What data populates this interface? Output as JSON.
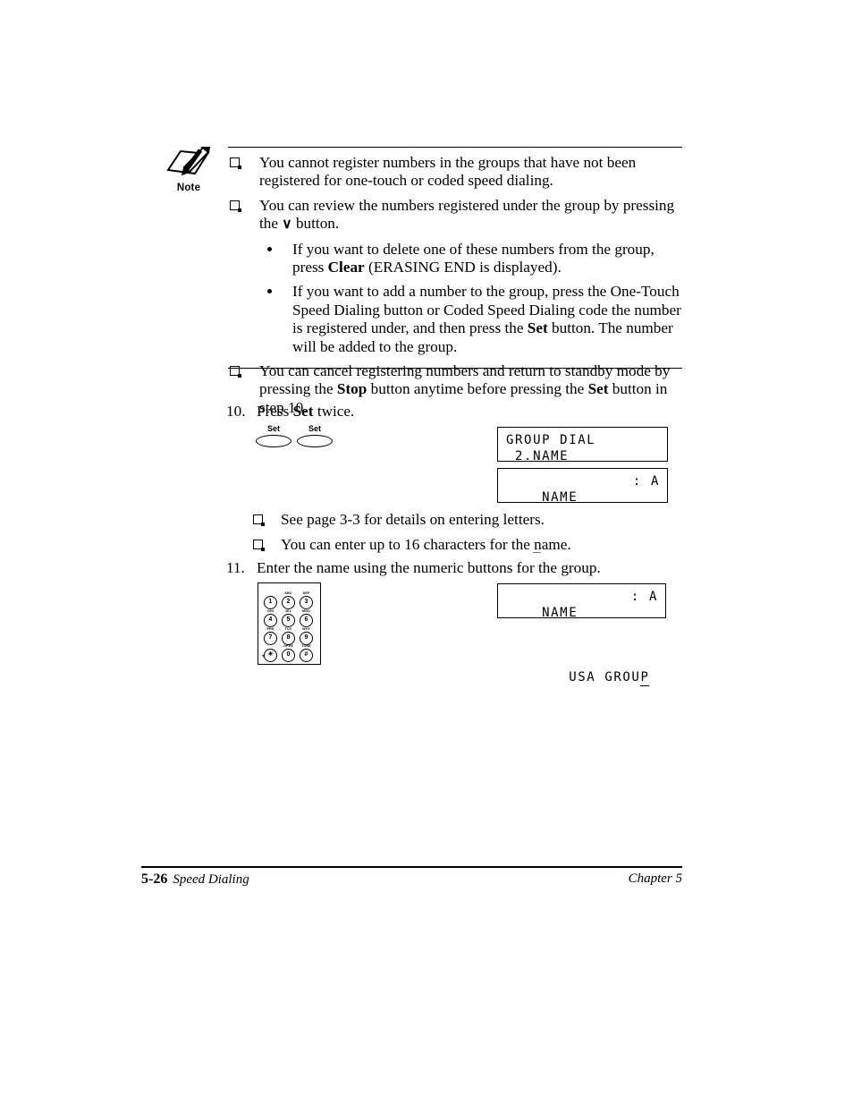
{
  "note_block": {
    "icon_name": "note-pencil-icon",
    "icon_label": "Note",
    "items": [
      {
        "type": "square",
        "segments": [
          {
            "text": "You cannot register numbers in the groups that have not been registered for one-touch or coded speed dialing.",
            "bold": false
          }
        ]
      },
      {
        "type": "square",
        "segments": [
          {
            "text": "You can review the numbers registered under the group by pressing the ",
            "bold": false
          },
          {
            "text": "∨",
            "bold": false,
            "glyph": true
          },
          {
            "text": " button.",
            "bold": false
          }
        ]
      },
      {
        "type": "dot",
        "segments": [
          {
            "text": "If you want to delete one of these numbers from the group, press ",
            "bold": false
          },
          {
            "text": "Clear",
            "bold": true
          },
          {
            "text": " (ERASING END is displayed).",
            "bold": false
          }
        ]
      },
      {
        "type": "dot",
        "segments": [
          {
            "text": "If you want to add a number to the group, press the One-Touch Speed Dialing button or Coded Speed Dialing code the number is registered under, and then press the ",
            "bold": false
          },
          {
            "text": "Set",
            "bold": true
          },
          {
            "text": " button. The number will be added to the group.",
            "bold": false
          }
        ]
      },
      {
        "type": "square",
        "segments": [
          {
            "text": "You can cancel registering numbers and return to standby mode by pressing the ",
            "bold": false
          },
          {
            "text": "Stop",
            "bold": true
          },
          {
            "text": " button anytime before pressing the ",
            "bold": false
          },
          {
            "text": "Set",
            "bold": true
          },
          {
            "text": " button in step 10.",
            "bold": false
          }
        ]
      }
    ]
  },
  "step_10": {
    "number": "10.",
    "segments": [
      {
        "text": "Press ",
        "bold": false
      },
      {
        "text": "Set",
        "bold": true
      },
      {
        "text": " twice.",
        "bold": false
      }
    ]
  },
  "set_buttons": [
    {
      "label": "Set"
    },
    {
      "label": "Set"
    }
  ],
  "lcd_1": {
    "line1": "GROUP DIAL",
    "line2": " 2.NAME"
  },
  "lcd_2": {
    "line1_left": "NAME",
    "line1_right": ": A",
    "line2": "   _"
  },
  "mid_notes": [
    {
      "text": "See page 3-3 for details on entering letters."
    },
    {
      "text": "You can enter up to 16 characters for the name."
    }
  ],
  "step_11": {
    "number": "11.",
    "segments": [
      {
        "text": "Enter the name using the numeric buttons for the group.",
        "bold": false
      }
    ]
  },
  "lcd_3": {
    "line1_left": "NAME",
    "line1_right": ": A",
    "line2_prefix": "   USA GROU",
    "line2_cursor": "P"
  },
  "keypad": {
    "tone_label": "Tone",
    "keys": [
      {
        "digit": "1",
        "letters": ""
      },
      {
        "digit": "2",
        "letters": "ABC"
      },
      {
        "digit": "3",
        "letters": "DEF"
      },
      {
        "digit": "4",
        "letters": "GHI"
      },
      {
        "digit": "5",
        "letters": "JKL"
      },
      {
        "digit": "6",
        "letters": "MNO"
      },
      {
        "digit": "7",
        "letters": "PRS"
      },
      {
        "digit": "8",
        "letters": "TUV"
      },
      {
        "digit": "9",
        "letters": "WXY"
      },
      {
        "digit": "✳",
        "letters": ""
      },
      {
        "digit": "0",
        "letters": "OPER"
      },
      {
        "digit": "#",
        "letters": "TONE"
      }
    ]
  },
  "footer": {
    "page_number": "5-26",
    "section": "Speed Dialing",
    "chapter": "Chapter 5"
  }
}
